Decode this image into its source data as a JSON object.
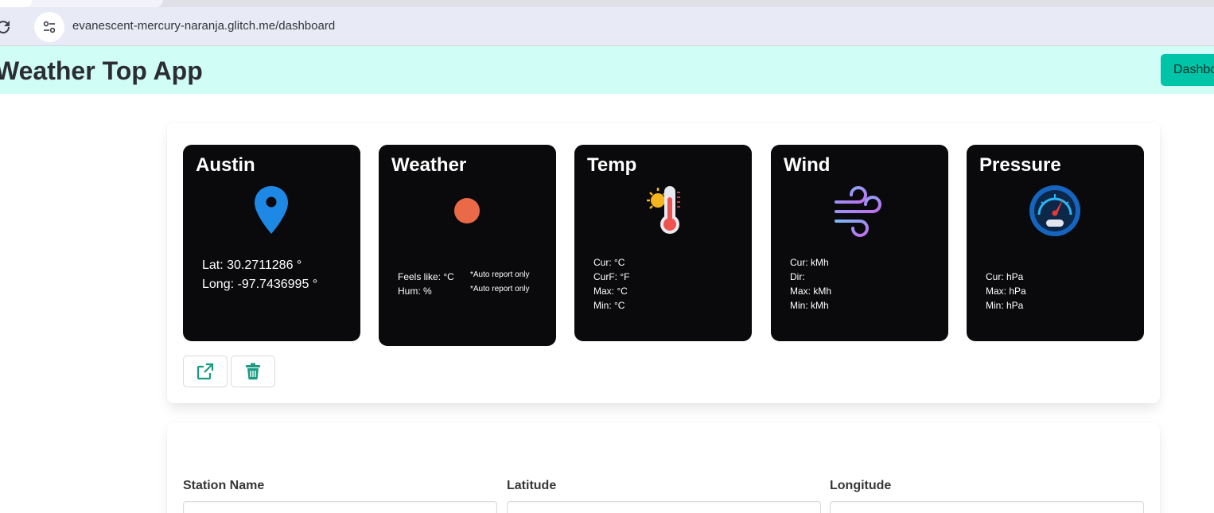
{
  "browser": {
    "url": "evanescent-mercury-naranja.glitch.me/dashboard"
  },
  "navbar": {
    "brand": "Weather Top App",
    "dashboard_label": "Dashboard"
  },
  "station": {
    "location_card": {
      "title": "Austin",
      "lat": "Lat: 30.2711286 °",
      "long": "Long: -97.7436995 °"
    },
    "weather_card": {
      "title": "Weather",
      "feels_like": "Feels like: °C",
      "hum": "Hum: %",
      "note1": "*Auto report only",
      "note2": "*Auto report only"
    },
    "temp_card": {
      "title": "Temp",
      "cur": "Cur: °C",
      "curf": "CurF: °F",
      "max": "Max: °C",
      "min": "Min: °C"
    },
    "wind_card": {
      "title": "Wind",
      "cur": "Cur: kMh",
      "dir": "Dir:",
      "max": "Max: kMh",
      "min": "Min: kMh"
    },
    "pressure_card": {
      "title": "Pressure",
      "cur": "Cur: hPa",
      "max": "Max: hPa",
      "min": "Min: hPa"
    },
    "icons": {
      "open": "external-link-icon",
      "delete": "trash-icon",
      "location": "map-pin-icon",
      "weather": "weather-status-dot-icon",
      "temp": "thermometer-sun-icon",
      "wind": "wind-icon",
      "pressure": "gauge-icon"
    },
    "colors": {
      "card_bg": "#0a0a0c",
      "accent": "#00c4a7",
      "button_icon": "#1a9b82"
    }
  },
  "form": {
    "station_name_label": "Station Name",
    "latitude_label": "Latitude",
    "longitude_label": "Longitude"
  }
}
